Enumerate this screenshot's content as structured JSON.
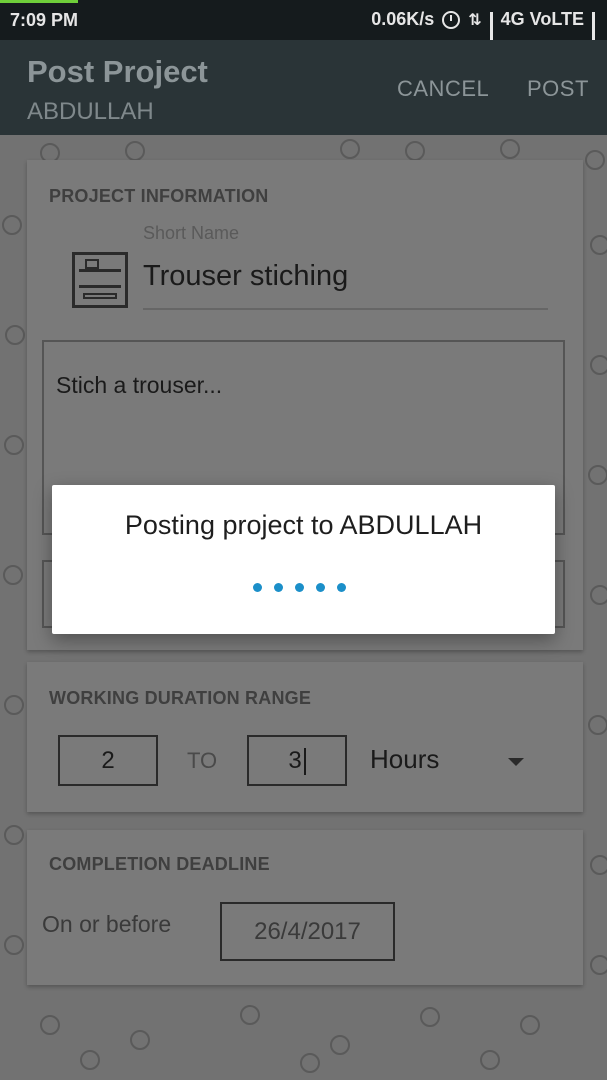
{
  "status_bar": {
    "time": "7:09 PM",
    "net_speed": "0.06K/s",
    "network": "4G VoLTE",
    "icons": [
      "alarm-icon",
      "data-arrows-icon",
      "signal-icon",
      "signal-icon"
    ]
  },
  "app_bar": {
    "title": "Post Project",
    "subtitle": "ABDULLAH",
    "cancel_label": "CANCEL",
    "post_label": "POST"
  },
  "project_info": {
    "heading": "PROJECT INFORMATION",
    "short_name_label": "Short Name",
    "short_name_value": "Trouser stiching",
    "description_value": "Stich a trouser..."
  },
  "duration": {
    "heading": "WORKING DURATION RANGE",
    "from_value": "2",
    "to_label": "TO",
    "to_value": "3",
    "unit_value": "Hours"
  },
  "deadline": {
    "heading": "COMPLETION DEADLINE",
    "label": "On or before",
    "date_value": "26/4/2017"
  },
  "dialog": {
    "message": "Posting project to ABDULLAH"
  },
  "colors": {
    "accent": "#1b8fc9",
    "app_bar": "#2a3437",
    "status_bar": "#151b1d"
  }
}
